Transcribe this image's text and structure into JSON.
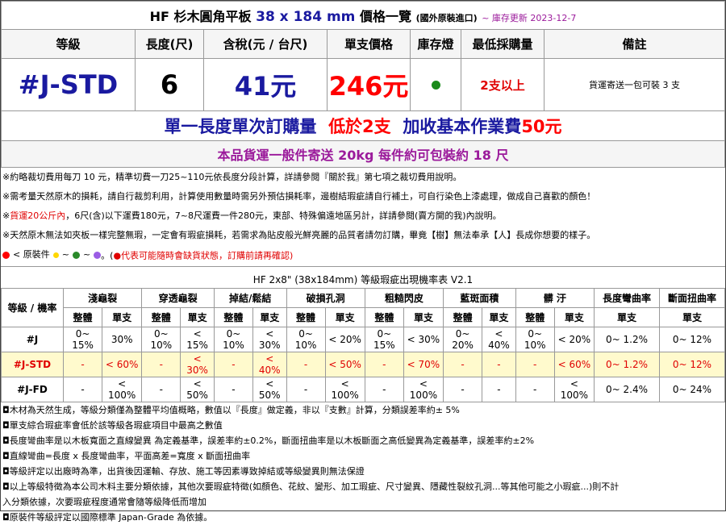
{
  "title": {
    "main": "HF 杉木圓角平板",
    "dim": "38 x 184 mm",
    "list": "價格一覽",
    "origin": "(國外原裝進口)",
    "updated": "~ 庫存更新 2023-12-7"
  },
  "headers": [
    "等級",
    "長度(尺)",
    "含稅(元 / 台尺)",
    "單支價格",
    "庫存燈",
    "最低採購量",
    "備註"
  ],
  "product": {
    "grade": "#J-STD",
    "length": "6",
    "tax_price": "41元",
    "unit_price": "246元",
    "stock_color": "#1a8a1a",
    "min_qty": "2支以上",
    "note": "貨運寄送一包可裝 3 支"
  },
  "banner1": {
    "part1": "單一長度單次訂購量",
    "part2": "低於2支",
    "part3": "加收基本作業費",
    "part4": "50元"
  },
  "banner2": "本品貨運一般件寄送 20kg 每件約可包裝約 18 尺",
  "notes": [
    "※約略裁切費用每刀 10 元，精準切費一刀25~110元依長度分段計算，詳請參閱『關於我』第七項之裁切費用說明。",
    "※需考量天然原木的損耗，請自行裁剪利用，計算使用數量時需另外預估損耗率，邊樹結瑕疵請自行補土，可自行染色上漆處理，做成自己喜歡的顏色！",
    "貨運20公斤內",
    "，6尺(含)以下運費180元，7~8尺運費一件280元，東部、特殊偏遠地區另計，詳請參閱(賣方開的我)內說明。",
    "※天然原木無法如夾板一樣完整無瑕，一定會有瑕疵損耗，若需求為貼皮般光鮮亮麗的品質者請勿訂購，畢竟【樹】無法奉承【人】長成你想要的樣子。"
  ],
  "legend": {
    "label": "< 原裝件",
    "tilde": "~",
    "suffix": "。(",
    "warning": "●代表可能隨時會缺貨狀態，訂購前請再確認)",
    "colors": [
      "#ff0000",
      "#ffd700",
      "#2a8a2a",
      "#9b5de5"
    ]
  },
  "defect": {
    "title": "HF 2x8\" (38x184mm) 等級瑕疵出現機率表 V2.1",
    "grade_label": "等級 / 機率",
    "categories": [
      "淺龜裂",
      "穿透龜裂",
      "掉結/鬆結",
      "破損孔洞",
      "粗糙閃皮",
      "藍斑面積",
      "髒 汙",
      "長度彎曲率",
      "斷面扭曲率"
    ],
    "whole": "整體",
    "single": "單支",
    "rows": [
      {
        "grade": "#J",
        "cells": [
          "0~ 15%",
          "30%",
          "0~ 10%",
          "< 15%",
          "0~ 10%",
          "< 30%",
          "0~ 10%",
          "< 20%",
          "0~ 15%",
          "< 30%",
          "0~ 20%",
          "< 40%",
          "0~ 10%",
          "< 20%",
          "0~ 1.2%",
          "0~ 12%"
        ]
      },
      {
        "grade": "#J-STD",
        "cells": [
          "-",
          "< 60%",
          "-",
          "< 30%",
          "-",
          "< 40%",
          "-",
          "< 50%",
          "-",
          "< 70%",
          "-",
          "-",
          "-",
          "< 60%",
          "0~ 1.2%",
          "0~ 12%"
        ]
      },
      {
        "grade": "#J-FD",
        "cells": [
          "-",
          "< 100%",
          "-",
          "< 50%",
          "-",
          "< 50%",
          "-",
          "< 100%",
          "-",
          "< 100%",
          "-",
          "-",
          "-",
          "< 100%",
          "0~ 2.4%",
          "0~ 24%"
        ]
      }
    ]
  },
  "footnotes": [
    "◘木材為天然生成，等級分類僅為整體平均值概略，數值以『長度』做定義，非以『支數』計算，分類誤差率約± 5%",
    "◘單支綜合瑕疵率會低於該等級各瑕疵項目中最高之數值",
    "◘長度彎曲率是以木板寬面之直線變異 為定義基準，誤差率約±0.2%，斷面扭曲率是以木板斷面之高低變異為定義基準，誤差率約±2%",
    "◘直線彎曲=長度 x 長度彎曲率，平面高差=寬度 x 斷面扭曲率",
    "◘等級評定以出廠時為準，出貨後因運輸、存放、施工等因素導致掉結或等級變異則無法保證",
    "◘以上等級特徵為本公司木料主要分類依據，其他次要瑕疵特徵(如顏色、花紋、變形、加工瑕疵、尺寸變異、隱藏性裂紋孔洞...等其他可能之小瑕疵...)則不計",
    "入分類依據，次要瑕疵程度通常會隨等級降低而增加",
    "◘原裝件等級評定以國際標準 Japan-Grade 為依據。"
  ]
}
